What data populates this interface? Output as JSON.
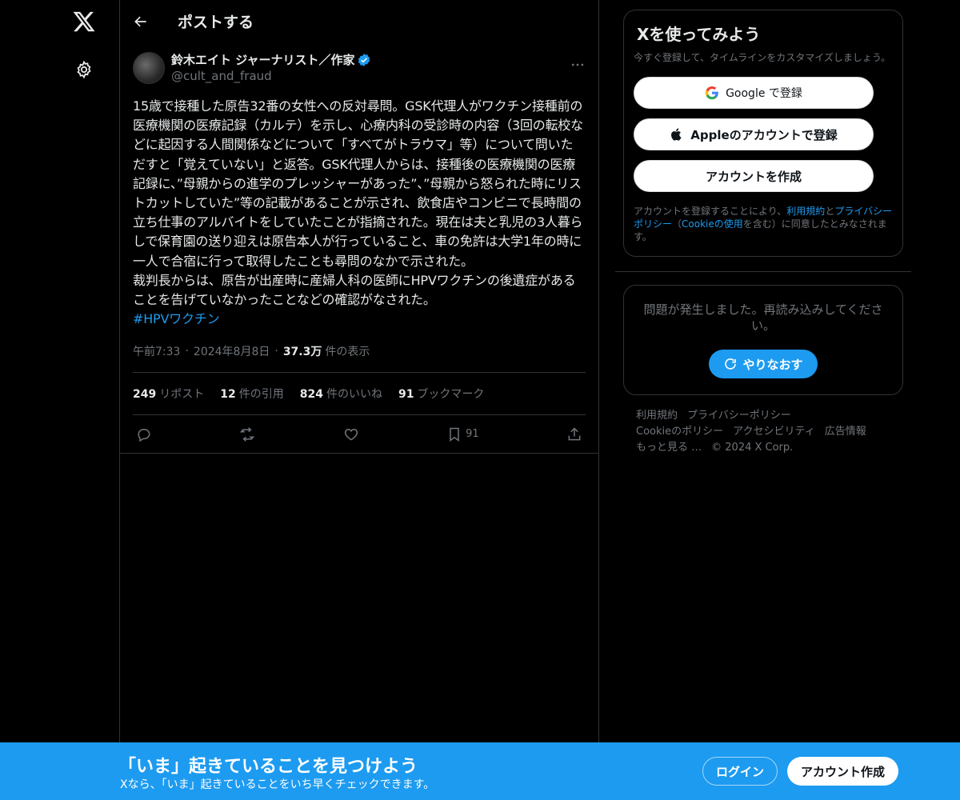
{
  "nav": {
    "logo_icon": "x-logo-icon",
    "settings_icon": "gear-icon"
  },
  "header": {
    "title": "ポストする",
    "back_icon": "arrow-left-icon"
  },
  "post": {
    "author_name": "鈴木エイト ジャーナリスト／作家",
    "author_handle": "@cult_and_fraud",
    "verified": true,
    "text": "15歳で接種した原告32番の女性への反対尋問。GSK代理人がワクチン接種前の医療機関の医療記録（カルテ）を示し、心療内科の受診時の内容（3回の転校などに起因する人間関係などについて「すべてがトラウマ」等）について問いただすと「覚えていない」と返答。GSK代理人からは、接種後の医療機関の医療記録に、”母親からの進学のプレッシャーがあった”、”母親から怒られた時にリストカットしていた”等の記載があることが示され、飲食店やコンビニで長時間の立ち仕事のアルバイトをしていたことが指摘された。現在は夫と乳児の3人暮らしで保育園の送り迎えは原告本人が行っていること、車の免許は大学1年の時に一人で合宿に行って取得したことも尋問のなかで示された。\n裁判長からは、原告が出産時に産婦人科の医師にHPVワクチンの後遺症があることを告げていなかったことなどの確認がなされた。",
    "hashtag": "#HPVワクチン",
    "time": "午前7:33",
    "date": "2024年8月8日",
    "views_count": "37.3万",
    "views_label": "件の表示",
    "stats": {
      "reposts_count": "249",
      "reposts_label": "リポスト",
      "quotes_count": "12",
      "quotes_label": "件の引用",
      "likes_count": "824",
      "likes_label": "件のいいね",
      "bookmarks_count": "91",
      "bookmarks_label": "ブックマーク"
    },
    "actions": {
      "bookmark_count": "91"
    }
  },
  "signup_card": {
    "title": "Xを使ってみよう",
    "subtitle": "今すぐ登録して、タイムラインをカスタマイズしましょう。",
    "google_label": "Google で登録",
    "apple_label": "Appleのアカウントで登録",
    "create_label": "アカウントを作成",
    "legal_prefix": "アカウントを登録することにより、",
    "terms_link": "利用規約",
    "legal_and": "と",
    "privacy_link": "プライバシーポリシー",
    "legal_paren_open": "（",
    "cookie_link": "Cookieの使用",
    "legal_suffix": "を含む）に同意したとみなされます。"
  },
  "error_card": {
    "message": "問題が発生しました。再読み込みしてください。",
    "retry_label": "やりなおす"
  },
  "footer": {
    "links": [
      "利用規約",
      "プライバシーポリシー",
      "Cookieのポリシー",
      "アクセシビリティ",
      "広告情報",
      "もっと見る …"
    ],
    "copyright": "© 2024 X Corp."
  },
  "banner": {
    "title": "「いま」起きていることを見つけよう",
    "subtitle": "Xなら、「いま」起きていることをいち早くチェックできます。",
    "login_label": "ログイン",
    "signup_label": "アカウント作成"
  },
  "colors": {
    "accent": "#1d9bf0",
    "background": "#000000",
    "border": "#2f3336",
    "muted": "#71767b"
  }
}
